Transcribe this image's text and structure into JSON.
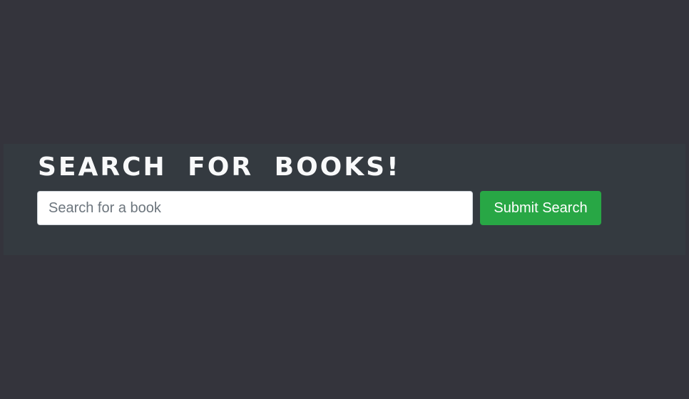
{
  "jumbotron": {
    "heading": "SEARCH FOR BOOKS!"
  },
  "search": {
    "placeholder": "Search for a book",
    "value": "",
    "submit_label": "Submit Search"
  },
  "colors": {
    "page_background": "#34343c",
    "band_background": "#343a40",
    "heading_text": "#f8f9fa",
    "submit_button": "#28a745"
  }
}
